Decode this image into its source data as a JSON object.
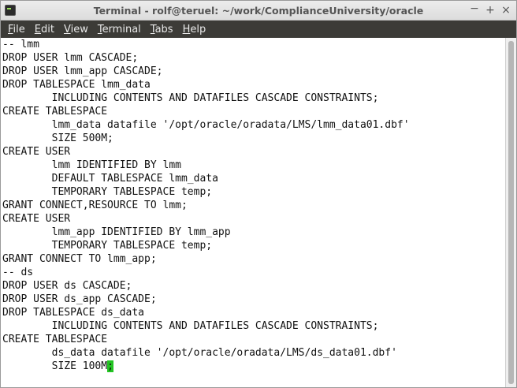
{
  "window": {
    "title": "Terminal - rolf@teruel: ~/work/ComplianceUniversity/oracle",
    "controls": {
      "minimize": "−",
      "maximize": "+",
      "close": "×"
    }
  },
  "menu": {
    "items": [
      {
        "key": "F",
        "rest": "ile"
      },
      {
        "key": "E",
        "rest": "dit"
      },
      {
        "key": "V",
        "rest": "iew"
      },
      {
        "key": "T",
        "rest": "erminal"
      },
      {
        "key": "T",
        "rest": "abs"
      },
      {
        "key": "H",
        "rest": "elp"
      }
    ]
  },
  "terminal": {
    "lines": [
      "-- lmm",
      "DROP USER lmm CASCADE;",
      "DROP USER lmm_app CASCADE;",
      "DROP TABLESPACE lmm_data",
      "        INCLUDING CONTENTS AND DATAFILES CASCADE CONSTRAINTS;",
      "CREATE TABLESPACE",
      "        lmm_data datafile '/opt/oracle/oradata/LMS/lmm_data01.dbf'",
      "        SIZE 500M;",
      "CREATE USER",
      "        lmm IDENTIFIED BY lmm",
      "        DEFAULT TABLESPACE lmm_data",
      "        TEMPORARY TABLESPACE temp;",
      "GRANT CONNECT,RESOURCE TO lmm;",
      "CREATE USER",
      "        lmm_app IDENTIFIED BY lmm_app",
      "        TEMPORARY TABLESPACE temp;",
      "GRANT CONNECT TO lmm_app;",
      "-- ds",
      "DROP USER ds CASCADE;",
      "DROP USER ds_app CASCADE;",
      "DROP TABLESPACE ds_data",
      "        INCLUDING CONTENTS AND DATAFILES CASCADE CONSTRAINTS;",
      "CREATE TABLESPACE",
      "        ds_data datafile '/opt/oracle/oradata/LMS/ds_data01.dbf'",
      "        SIZE 100M"
    ],
    "cursor_char": ";",
    "cursor_color": "#22c322"
  }
}
